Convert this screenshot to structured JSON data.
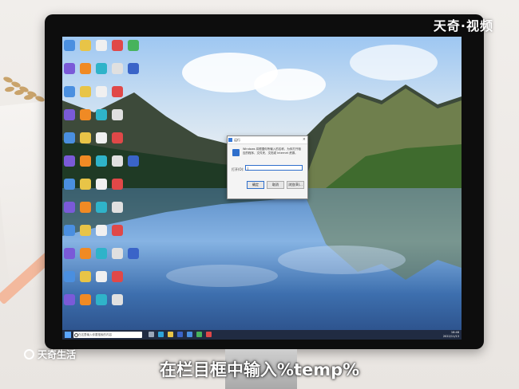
{
  "watermark": {
    "top": "天奇·视频",
    "bottom": "天奇生活"
  },
  "subtitle": "在栏目框中输入%temp%",
  "dialog": {
    "title": "运行",
    "close": "×",
    "description": "Windows 将根据你所输入的名称，为你打开相应的程序、文件夹、文档或 Internet 资源。",
    "open_label": "打开(O):",
    "input_value": "|",
    "buttons": [
      "确定",
      "取消",
      "浏览(B)..."
    ]
  },
  "taskbar": {
    "search_placeholder": "在这里输入你要搜索的内容",
    "time": "16:48",
    "date": "2022/11/13"
  },
  "icon_colors": [
    "#4a8fe0",
    "#e8c447",
    "#f0f0f0",
    "#e04848",
    "#47b35c",
    "#7a5ad8",
    "#f08a24",
    "#2fb3c9",
    "#e0e0e0",
    "#3a64c8"
  ]
}
